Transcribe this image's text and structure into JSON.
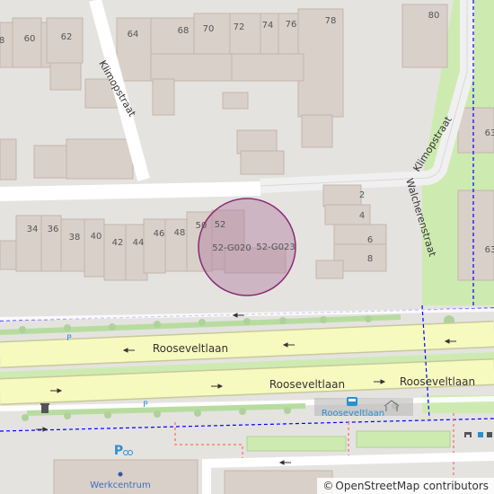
{
  "map": {
    "streets": {
      "klimopstraat": "Klimopstraat",
      "walcherenstraat": "Walcherenstraat",
      "rooseveltlaan": "Rooseveltlaan"
    },
    "house_numbers": {
      "n8": "8",
      "n60": "60",
      "n62": "62",
      "n64": "64",
      "n68": "68",
      "n70": "70",
      "n72": "72",
      "n74": "74",
      "n76": "76",
      "n78": "78",
      "n80": "80",
      "n34": "34",
      "n36": "36",
      "n38": "38",
      "n40": "40",
      "n42": "42",
      "n44": "44",
      "n46": "46",
      "n48": "48",
      "n50": "50",
      "n52": "52",
      "g020": "52-G020",
      "g023": "52-G023",
      "n2": "2",
      "n4": "4",
      "n6": "6",
      "n8b": "8",
      "n63a": "63",
      "n63b": "63"
    },
    "pois": {
      "bus_stop": "Rooseveltlaan",
      "parking_p1": "P",
      "parking_p2": "P",
      "werkcentrum": "Werkcentrum"
    },
    "colors": {
      "background": "#e5e3e0",
      "building": "#d9d0c9",
      "building_stroke": "#c4b6ab",
      "primary_road": "#f7fabf",
      "road_casing": "#c7c99a",
      "footway": "#ffffff",
      "grass": "#cdebb0",
      "highlight_fill": "#b07ca0",
      "highlight_stroke": "#8a2a72",
      "cycleway": "#0000ff",
      "footpath": "#fa8072",
      "bus_blue": "#2b8fd0"
    }
  },
  "attribution": {
    "symbol": "©",
    "text": "OpenStreetMap contributors"
  }
}
